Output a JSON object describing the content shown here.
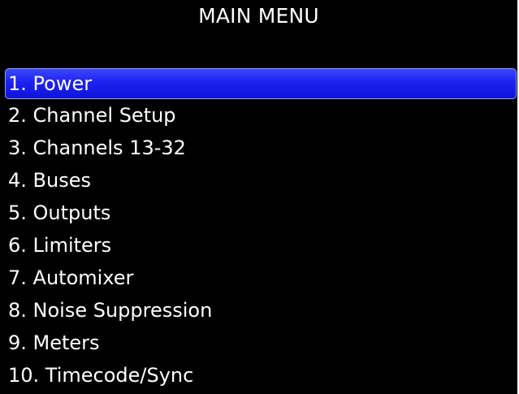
{
  "header": {
    "title": "MAIN MENU"
  },
  "menu": {
    "selected_index": 0,
    "items": [
      {
        "label": "1. Power"
      },
      {
        "label": "2. Channel Setup"
      },
      {
        "label": "3. Channels 13-32"
      },
      {
        "label": "4. Buses"
      },
      {
        "label": "5. Outputs"
      },
      {
        "label": "6. Limiters"
      },
      {
        "label": "7. Automixer"
      },
      {
        "label": "8. Noise Suppression"
      },
      {
        "label": "9. Meters"
      },
      {
        "label": "10. Timecode/Sync"
      }
    ]
  },
  "colors": {
    "background": "#000000",
    "text": "#ffffff",
    "highlight": "#1c22f0",
    "highlight_border": "#8fa0ff"
  }
}
